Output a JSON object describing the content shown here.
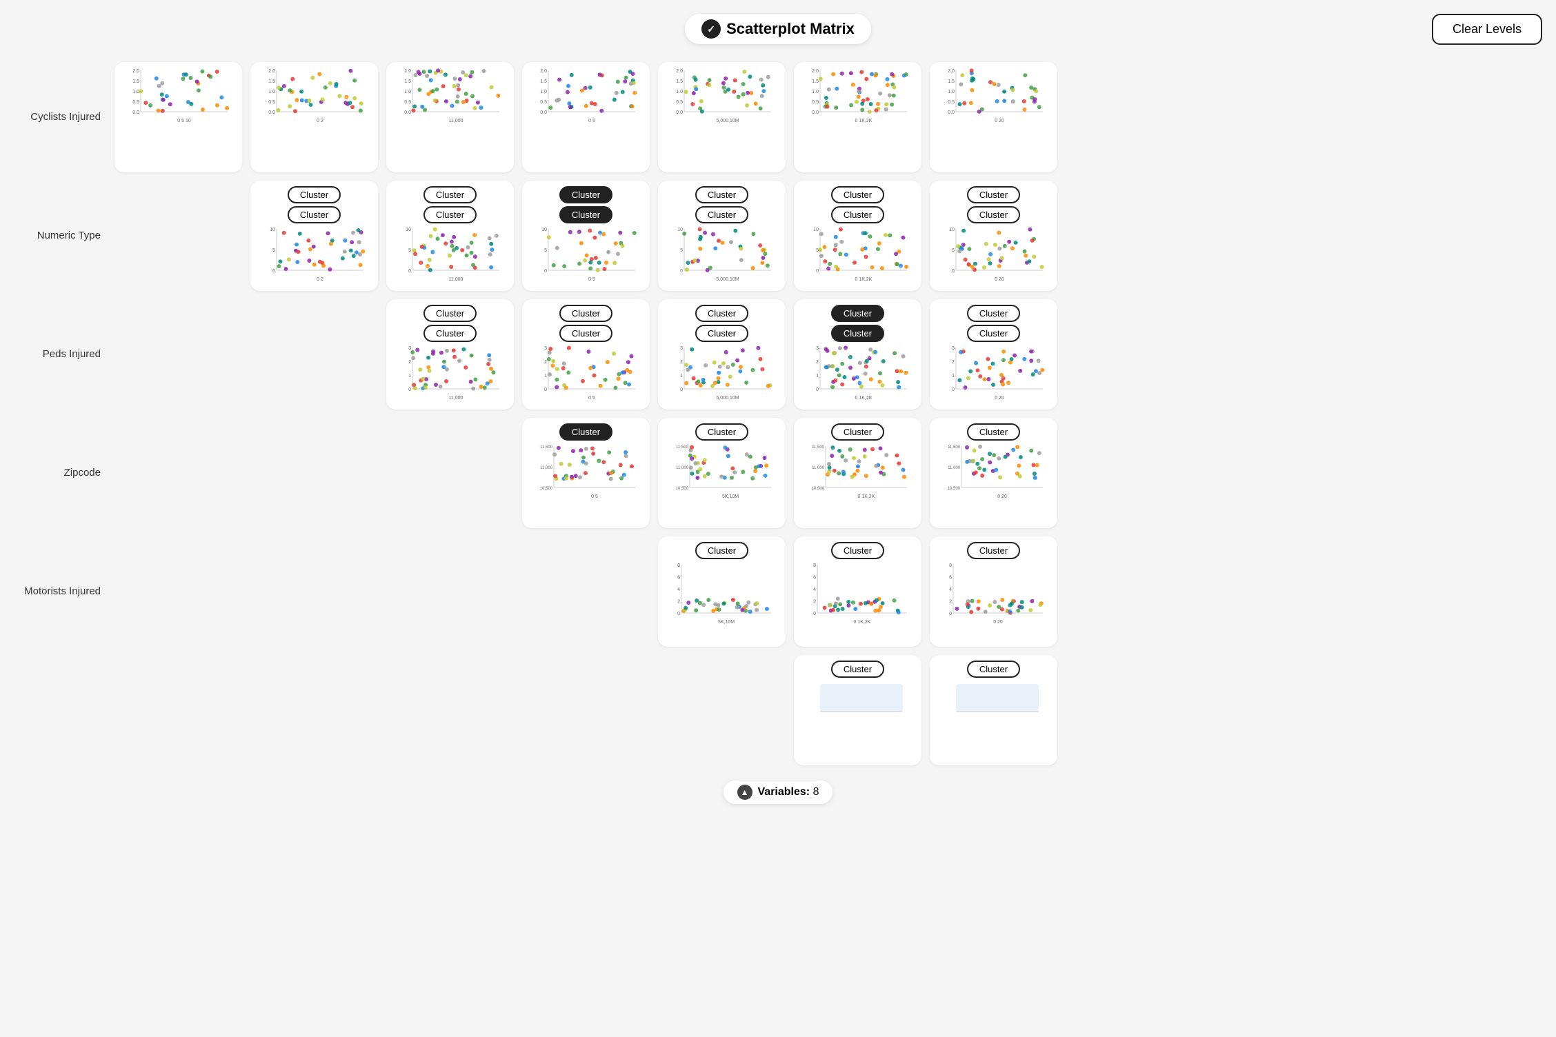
{
  "header": {
    "title": "Scatterplot Matrix",
    "clear_levels_label": "Clear Levels",
    "variables_label": "Variables:",
    "variables_count": "8"
  },
  "rows": [
    {
      "label": "Cyclists Injured",
      "cells": [
        {
          "type": "chart_only",
          "x_label": "0  5  10",
          "y_label": "2.0\n1.5\n1.0\n0.5\n0.0"
        },
        {
          "type": "chart_only",
          "x_label": "0   2",
          "y_label": "2.0\n1.5\n1.0\n0.5\n0.0"
        },
        {
          "type": "chart_only",
          "x_label": "11,000",
          "y_label": "2.0\n1.5\n1.0\n0.5\n0.0"
        },
        {
          "type": "chart_only",
          "x_label": "0   5",
          "y_label": "2.0\n1.5\n1.0\n0.5\n0.0"
        },
        {
          "type": "chart_only",
          "x_label": "5,000 10,000,000",
          "y_label": "2.0\n1.5\n1.0\n0.5\n0.0"
        },
        {
          "type": "chart_only",
          "x_label": "0  1,000 2,000",
          "y_label": "2.0\n1.5\n1.0\n0.5\n0.0"
        },
        {
          "type": "chart_only",
          "x_label": "0   20",
          "y_label": "2.0\n1.5\n1.0\n0.5\n0.0"
        }
      ]
    },
    {
      "label": "Numeric Type",
      "cells": [
        {
          "type": "empty"
        },
        {
          "type": "cluster_chart",
          "active": false,
          "cluster_label": "Cluster",
          "x_label": "0   2",
          "y_label": "10\n5\n0"
        },
        {
          "type": "cluster_chart",
          "active": false,
          "cluster_label": "Cluster",
          "x_label": "11,000",
          "y_label": "10\n5\n0"
        },
        {
          "type": "cluster_chart",
          "active": true,
          "cluster_label": "Cluster",
          "x_label": "0   5",
          "y_label": "10\n5\n0"
        },
        {
          "type": "cluster_chart",
          "active": false,
          "cluster_label": "Cluster",
          "x_label": "5,000 10,000,000",
          "y_label": "10\n5\n0"
        },
        {
          "type": "cluster_chart",
          "active": false,
          "cluster_label": "Cluster",
          "x_label": "0  1,000 2,000",
          "y_label": "10\n5\n0"
        },
        {
          "type": "cluster_chart",
          "active": false,
          "cluster_label": "Cluster",
          "x_label": "0   20",
          "y_label": "10\n5\n0"
        }
      ]
    },
    {
      "label": "Peds Injured",
      "cells": [
        {
          "type": "empty"
        },
        {
          "type": "empty"
        },
        {
          "type": "cluster_chart",
          "active": false,
          "cluster_label": "Cluster",
          "x_label": "11,000",
          "y_label": "3\n2\n1\n0"
        },
        {
          "type": "cluster_chart",
          "active": false,
          "cluster_label": "Cluster",
          "x_label": "0   5",
          "y_label": "3\n2\n1\n0"
        },
        {
          "type": "cluster_chart",
          "active": false,
          "cluster_label": "Cluster",
          "x_label": "5,000 10,000,000",
          "y_label": "3\n2\n1\n0"
        },
        {
          "type": "cluster_chart",
          "active": true,
          "cluster_label": "Cluster",
          "x_label": "0  1,000 2,000",
          "y_label": "3\n2\n1\n0"
        },
        {
          "type": "cluster_chart",
          "active": false,
          "cluster_label": "Cluster",
          "x_label": "0   20",
          "y_label": "3\n2\n1\n0"
        }
      ]
    },
    {
      "label": "Zipcode",
      "cells": [
        {
          "type": "empty"
        },
        {
          "type": "empty"
        },
        {
          "type": "empty"
        },
        {
          "type": "cluster_chart",
          "active": true,
          "cluster_label": "Cluster",
          "x_label": "0   5",
          "y_label": "11,500\n11,000\n10,500"
        },
        {
          "type": "cluster_chart",
          "active": false,
          "cluster_label": "Cluster",
          "x_label": "5,000 10,000,000",
          "y_label": "11,500\n11,000\n10,500"
        },
        {
          "type": "cluster_chart",
          "active": false,
          "cluster_label": "Cluster",
          "x_label": "0  1,000 2,000",
          "y_label": "11,500\n11,000\n10,500"
        },
        {
          "type": "cluster_chart",
          "active": false,
          "cluster_label": "Cluster",
          "x_label": "0   20",
          "y_label": "11,500\n11,000\n10,500"
        }
      ]
    },
    {
      "label": "Motorists Injured",
      "cells": [
        {
          "type": "empty"
        },
        {
          "type": "empty"
        },
        {
          "type": "empty"
        },
        {
          "type": "empty"
        },
        {
          "type": "cluster_chart",
          "active": false,
          "cluster_label": "Cluster",
          "x_label": "5,000 10,000,000",
          "y_label": "8\n6\n4\n2\n0"
        },
        {
          "type": "cluster_chart",
          "active": false,
          "cluster_label": "Cluster",
          "x_label": "0  1,000 2,000",
          "y_label": "8\n6\n4\n2\n0"
        },
        {
          "type": "cluster_chart",
          "active": false,
          "cluster_label": "Cluster",
          "x_label": "0   20",
          "y_label": "8\n6\n4\n2\n0"
        }
      ]
    },
    {
      "label": "",
      "cells": [
        {
          "type": "empty"
        },
        {
          "type": "empty"
        },
        {
          "type": "empty"
        },
        {
          "type": "empty"
        },
        {
          "type": "empty"
        },
        {
          "type": "cluster_chart",
          "active": false,
          "cluster_label": "Cluster",
          "x_label": "",
          "y_label": ""
        },
        {
          "type": "cluster_chart",
          "active": false,
          "cluster_label": "Cluster",
          "x_label": "",
          "y_label": ""
        }
      ]
    }
  ],
  "colors": {
    "dot_red": "#e53935",
    "dot_green": "#43a047",
    "dot_blue": "#1e88e5",
    "dot_purple": "#8e24aa",
    "dot_orange": "#fb8c00",
    "dot_gray": "#9e9e9e",
    "dot_teal": "#00897b",
    "dot_lime": "#c0ca33"
  }
}
